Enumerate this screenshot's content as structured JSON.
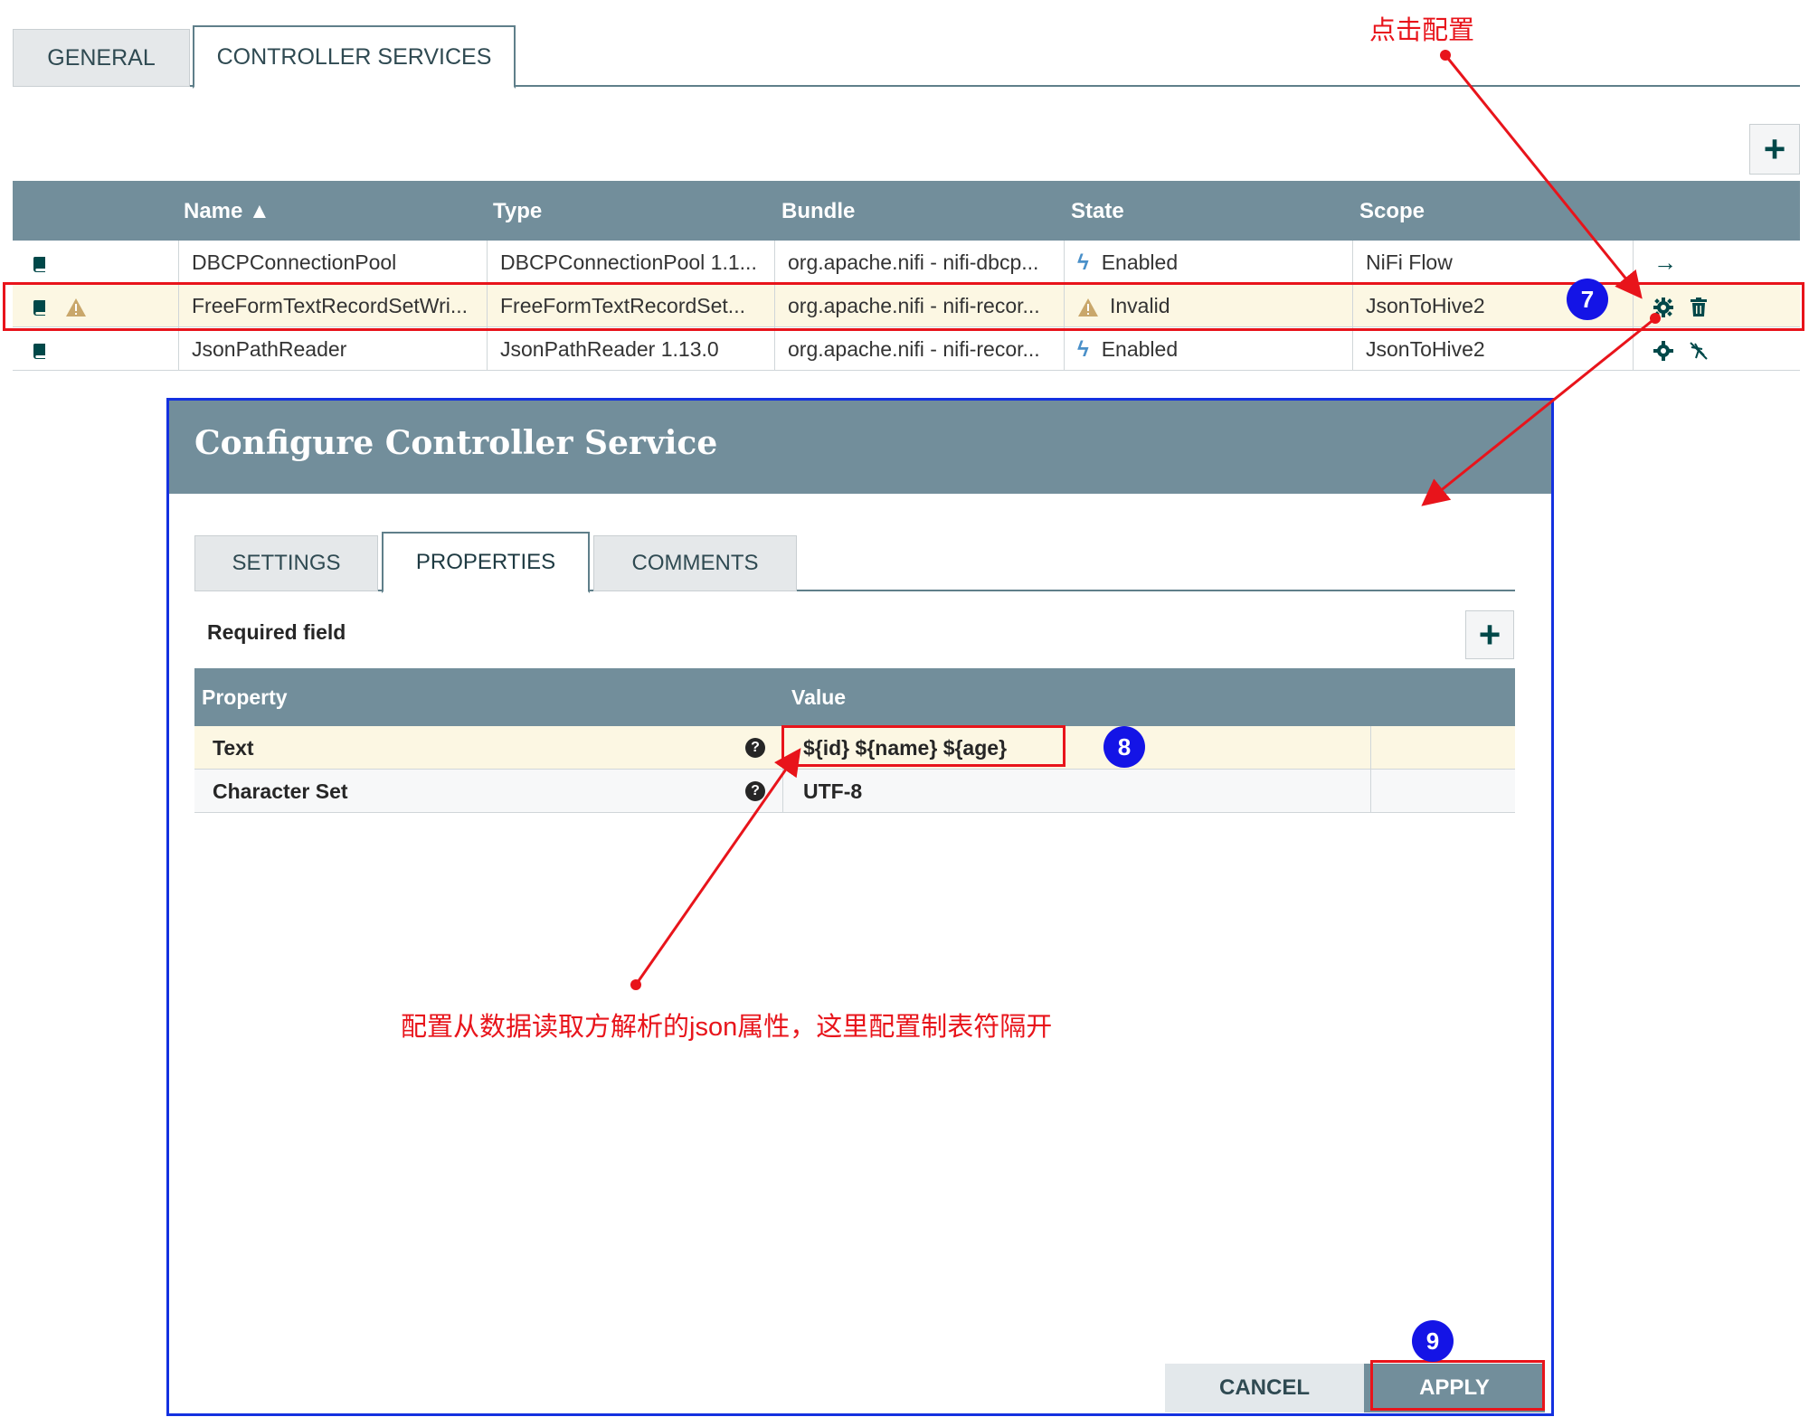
{
  "tabs": {
    "general": "GENERAL",
    "controller_services": "CONTROLLER SERVICES"
  },
  "add_label": "+",
  "services": {
    "headers": [
      "Name ▲",
      "Type",
      "Bundle",
      "State",
      "Scope"
    ],
    "rows": [
      {
        "name": "DBCPConnectionPool",
        "type": "DBCPConnectionPool 1.1...",
        "bundle": "org.apache.nifi - nifi-dbcp...",
        "state": "Enabled",
        "scope": "NiFi Flow"
      },
      {
        "name": "FreeFormTextRecordSetWri...",
        "type": "FreeFormTextRecordSet...",
        "bundle": "org.apache.nifi - nifi-recor...",
        "state": "Invalid",
        "scope": "JsonToHive2"
      },
      {
        "name": "JsonPathReader",
        "type": "JsonPathReader 1.13.0",
        "bundle": "org.apache.nifi - nifi-recor...",
        "state": "Enabled",
        "scope": "JsonToHive2"
      }
    ]
  },
  "dialog": {
    "title": "Configure Controller Service",
    "tabs": {
      "settings": "SETTINGS",
      "properties": "PROPERTIES",
      "comments": "COMMENTS"
    },
    "required_field": "Required field",
    "headers": {
      "property": "Property",
      "value": "Value"
    },
    "rows": [
      {
        "property": "Text",
        "value": "${id} ${name} ${age}"
      },
      {
        "property": "Character Set",
        "value": "UTF-8"
      }
    ],
    "cancel": "CANCEL",
    "apply": "APPLY"
  },
  "annotations": {
    "top_note": "点击配置",
    "mid_note": "配置从数据读取方解析的json属性，这里配置制表符隔开",
    "badge7": "7",
    "badge8": "8",
    "badge9": "9"
  },
  "colors": {
    "header_bg": "#728e9b",
    "selected_row": "#fcf7e3",
    "highlight_red": "#e8141b",
    "dialog_border": "#1431e0",
    "badge_blue": "#1414e6"
  }
}
